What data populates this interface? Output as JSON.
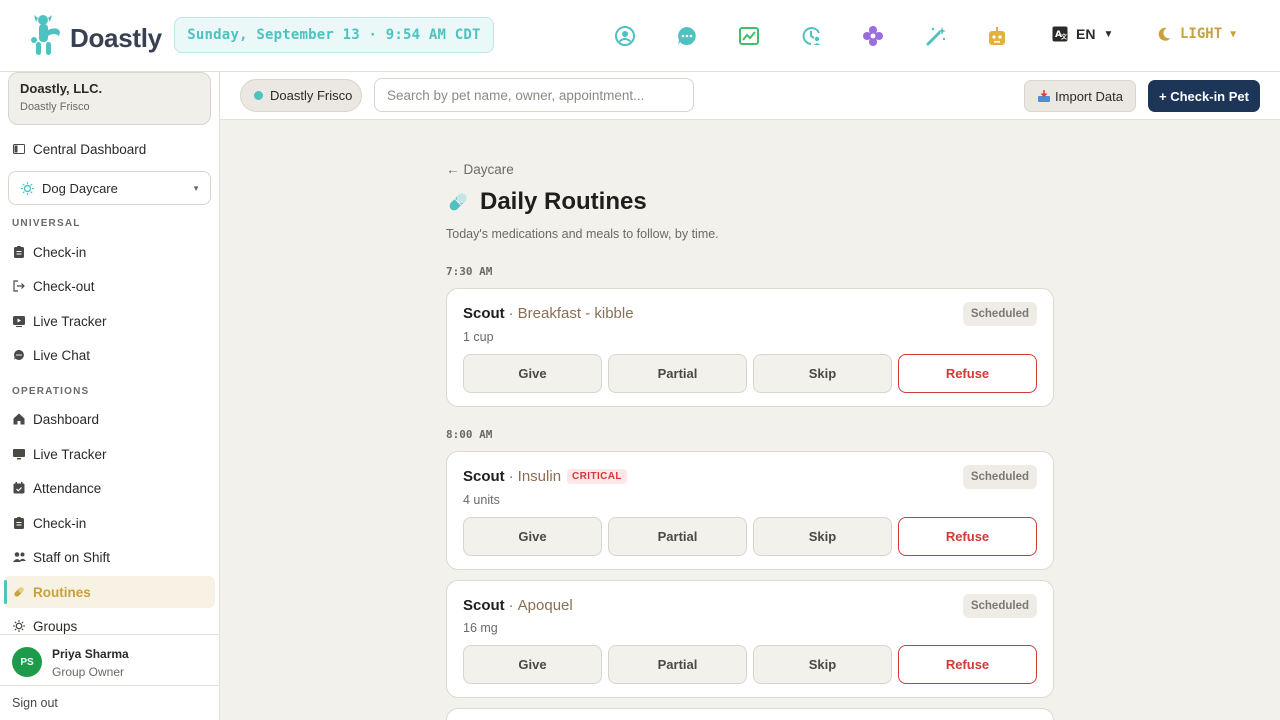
{
  "brand": {
    "name": "Doastly"
  },
  "header": {
    "datetime": "Sunday, September 13 · 9:54 AM CDT",
    "icons": [
      "user-circle-icon",
      "chat-icon",
      "chart-icon",
      "clock-user-icon",
      "settings-flower-icon",
      "magic-wand-icon",
      "robot-icon"
    ],
    "language": "EN",
    "theme": "LIGHT"
  },
  "sidebar": {
    "org_name": "Doastly, LLC.",
    "org_location": "Doastly Frisco",
    "central_dashboard": "Central Dashboard",
    "department": "Dog Daycare",
    "universal_label": "UNIVERSAL",
    "universal_items": [
      "Check-in",
      "Check-out",
      "Live Tracker",
      "Live Chat"
    ],
    "operations_label": "OPERATIONS",
    "operations_items": [
      "Dashboard",
      "Live Tracker",
      "Attendance",
      "Check-in",
      "Staff on Shift",
      "Routines",
      "Groups"
    ],
    "active_item": "Routines",
    "user": {
      "initials": "PS",
      "name": "Priya Sharma",
      "role": "Group Owner"
    },
    "sign_out": "Sign out"
  },
  "toolbar": {
    "location": "Doastly Frisco",
    "search_placeholder": "Search by pet name, owner, appointment...",
    "import_label": "Import Data",
    "checkin_label": "+ Check-in Pet"
  },
  "page": {
    "breadcrumb": "Daycare",
    "title": "Daily Routines",
    "subtitle": "Today's medications and meals to follow, by time."
  },
  "schedule": [
    {
      "time": "7:30 AM",
      "routines": [
        {
          "pet": "Scout",
          "item": "Breakfast - kibble",
          "critical": false,
          "dose": "1 cup",
          "status": "Scheduled"
        }
      ]
    },
    {
      "time": "8:00 AM",
      "routines": [
        {
          "pet": "Scout",
          "item": "Insulin",
          "critical": true,
          "critical_label": "CRITICAL",
          "dose": "4 units",
          "status": "Scheduled"
        },
        {
          "pet": "Scout",
          "item": "Apoquel",
          "critical": false,
          "dose": "16 mg",
          "status": "Scheduled"
        }
      ]
    }
  ],
  "actions": [
    "Give",
    "Partial",
    "Skip",
    "Refuse"
  ],
  "colors": {
    "accent": "#4fc1c1",
    "primary": "#1d3557",
    "danger": "#d23a3a",
    "gold": "#c8a13a"
  }
}
